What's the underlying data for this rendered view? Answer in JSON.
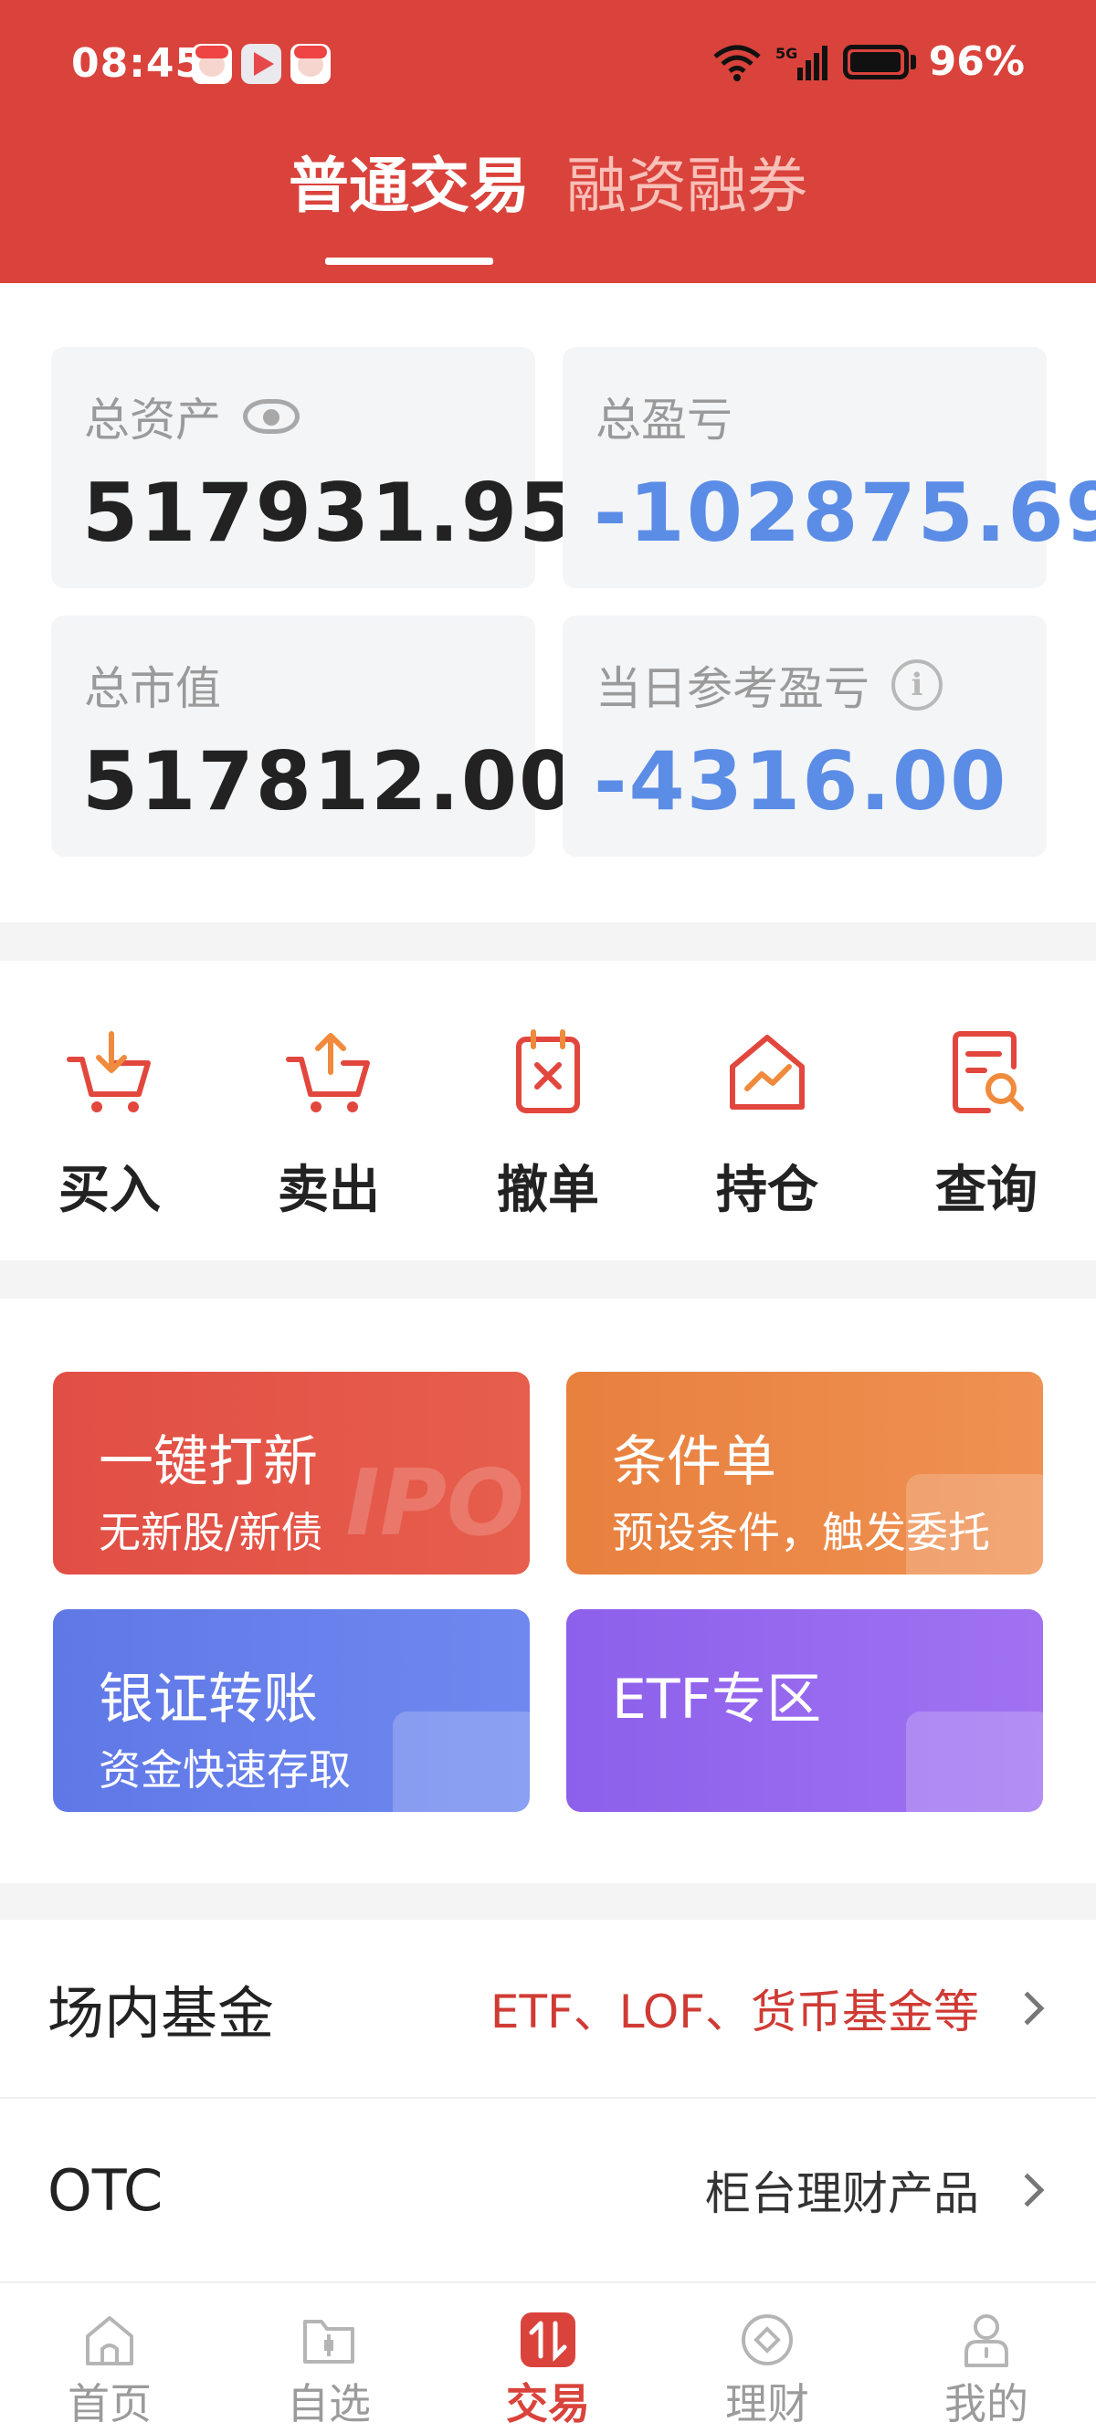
{
  "status_bar": {
    "time": "08:45",
    "battery": "96%"
  },
  "trade_tabs": [
    {
      "label": "普通交易",
      "active": true
    },
    {
      "label": "融资融券",
      "active": false
    }
  ],
  "assets": {
    "total_assets": {
      "label": "总资产",
      "value": "517931.95"
    },
    "total_pnl": {
      "label": "总盈亏",
      "value": "-102875.69"
    },
    "market_value": {
      "label": "总市值",
      "value": "517812.00"
    },
    "daily_pnl": {
      "label": "当日参考盈亏",
      "value": "-4316.00"
    }
  },
  "actions": [
    {
      "label": "买入",
      "icon": "cart-in-icon"
    },
    {
      "label": "卖出",
      "icon": "cart-out-icon"
    },
    {
      "label": "撤单",
      "icon": "cancel-order-icon"
    },
    {
      "label": "持仓",
      "icon": "holdings-icon"
    },
    {
      "label": "查询",
      "icon": "query-icon"
    }
  ],
  "tiles": [
    {
      "title": "一键打新",
      "subtitle": "无新股/新债",
      "deco": "IPO"
    },
    {
      "title": "条件单",
      "subtitle": "预设条件，触发委托"
    },
    {
      "title": "银证转账",
      "subtitle": "资金快速存取"
    },
    {
      "title": "ETF专区",
      "subtitle": ""
    }
  ],
  "list_rows": [
    {
      "title": "场内基金",
      "desc": "ETF、LOF、货币基金等"
    },
    {
      "title": "OTC",
      "desc": "柜台理财产品"
    }
  ],
  "bottom_nav": [
    {
      "label": "首页",
      "icon": "home-icon",
      "active": false
    },
    {
      "label": "自选",
      "icon": "watchlist-icon",
      "active": false
    },
    {
      "label": "交易",
      "icon": "trade-icon",
      "active": true
    },
    {
      "label": "理财",
      "icon": "wealth-icon",
      "active": false
    },
    {
      "label": "我的",
      "icon": "profile-icon",
      "active": false
    }
  ],
  "colors": {
    "brand_red": "#d9433c",
    "negative_blue": "#5b8de6",
    "icon_accent": "#e2473e"
  }
}
